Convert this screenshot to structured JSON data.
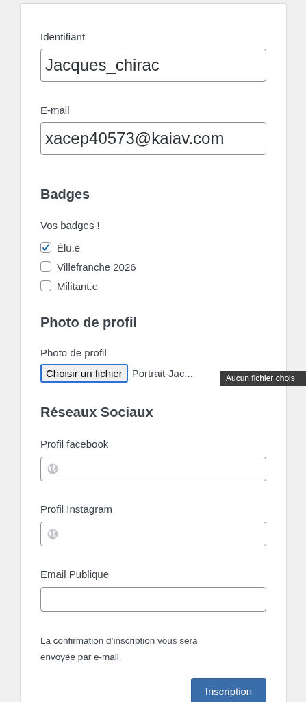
{
  "account_fields": [
    {
      "label": "Identifiant",
      "value": "Jacques_chirac"
    },
    {
      "label": "E-mail",
      "value": "xacep40573@kaiav.com"
    }
  ],
  "badges": {
    "heading": "Badges",
    "intro": "Vos badges !",
    "items": [
      {
        "label": "Élu.e",
        "checked": true
      },
      {
        "label": "Villefranche 2026",
        "checked": false
      },
      {
        "label": "Militant.e",
        "checked": false
      }
    ]
  },
  "photo": {
    "heading": "Photo de profil",
    "label": "Photo de profil",
    "button": "Choisir un fichier",
    "file_name": "Portrait-Jac...",
    "tooltip": "Aucun fichier chois"
  },
  "social": {
    "heading": "Réseaux Sociaux",
    "fields": [
      {
        "label": "Profil facebook",
        "kind": "url"
      },
      {
        "label": "Profil Instagram",
        "kind": "url"
      },
      {
        "label": "Email Publique",
        "kind": "email"
      }
    ]
  },
  "note": "La confirmation d’inscription vous sera envoyée par e-mail.",
  "submit": "Inscription"
}
